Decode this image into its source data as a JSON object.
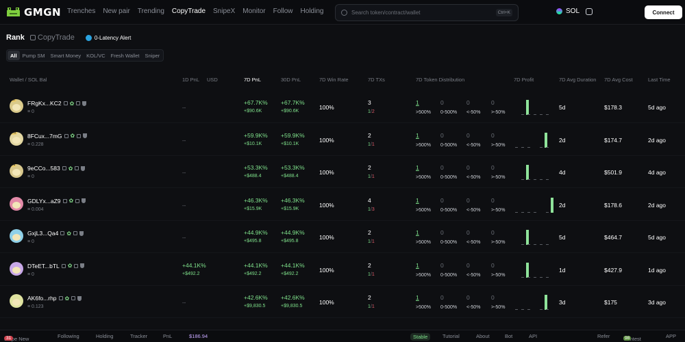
{
  "app": {
    "name": "GMGN"
  },
  "nav": [
    "Trenches",
    "New pair",
    "Trending",
    "CopyTrade",
    "SnipeX",
    "Monitor",
    "Follow",
    "Holding"
  ],
  "search": {
    "placeholder": "Search token/contract/wallet",
    "shortcut": "Ctrl+K"
  },
  "chain": {
    "label": "SOL"
  },
  "connect_label": "Connect",
  "page": {
    "title": "Rank",
    "copytrade": "CopyTrade",
    "alert": "0-Latency Alert"
  },
  "filters": [
    "All",
    "Pump SM",
    "Smart Money",
    "KOL/VC",
    "Fresh Wallet",
    "Sniper"
  ],
  "columns": [
    "Wallet / SOL Bal",
    "1D PnL",
    "USD",
    "7D PnL",
    "30D PnL",
    "7D Win Rate",
    "7D TXs",
    "7D Token Distribution",
    "7D Profit",
    "7D Avg Duration",
    "7D Avg Cost",
    "Last Time"
  ],
  "rows": [
    {
      "badge": "1st",
      "wallet": "FRgKx...KC2",
      "bal": "0",
      "d1": "--",
      "d1usd": "",
      "d7": "+67.7K%",
      "d7usd": "+$90.6K",
      "d30": "+67.7K%",
      "d30usd": "+$90.6K",
      "win": "100%",
      "tx": "3",
      "txw": "1",
      "txl": "2",
      "dist": [
        "1",
        "0",
        "0",
        "0"
      ],
      "bar": 0,
      "dur": "5d",
      "cost": "$178.3",
      "last": "5d ago",
      "avatar": "#d9c98a"
    },
    {
      "badge": "2nd",
      "wallet": "8FCux...7mG",
      "bal": "0.228",
      "d1": "--",
      "d1usd": "",
      "d7": "+59.9K%",
      "d7usd": "+$10.1K",
      "d30": "+59.9K%",
      "d30usd": "+$10.1K",
      "win": "100%",
      "tx": "2",
      "txw": "1",
      "txl": "1",
      "dist": [
        "1",
        "0",
        "0",
        "0"
      ],
      "bar": 3,
      "dur": "2d",
      "cost": "$174.7",
      "last": "2d ago",
      "avatar": "#e3d7a2"
    },
    {
      "badge": "3rd",
      "wallet": "9eCCo...583",
      "bal": "0",
      "d1": "--",
      "d1usd": "",
      "d7": "+53.3K%",
      "d7usd": "+$488.4",
      "d30": "+53.3K%",
      "d30usd": "+$488.4",
      "win": "100%",
      "tx": "2",
      "txw": "1",
      "txl": "1",
      "dist": [
        "1",
        "0",
        "0",
        "0"
      ],
      "bar": 0,
      "dur": "4d",
      "cost": "$501.9",
      "last": "4d ago",
      "avatar": "#d8c88d"
    },
    {
      "badge": "",
      "wallet": "GDLYx...aZ9",
      "bal": "0.004",
      "d1": "--",
      "d1usd": "",
      "d7": "+46.3K%",
      "d7usd": "+$15.9K",
      "d30": "+46.3K%",
      "d30usd": "+$15.9K",
      "win": "100%",
      "tx": "4",
      "txw": "1",
      "txl": "3",
      "dist": [
        "1",
        "0",
        "0",
        "0"
      ],
      "bar": 4,
      "dur": "2d",
      "cost": "$178.6",
      "last": "2d ago",
      "avatar": "#e38aa8"
    },
    {
      "badge": "",
      "wallet": "GxjL3...Qa4",
      "bal": "0",
      "d1": "--",
      "d1usd": "",
      "d7": "+44.9K%",
      "d7usd": "+$495.8",
      "d30": "+44.9K%",
      "d30usd": "+$495.8",
      "win": "100%",
      "tx": "2",
      "txw": "1",
      "txl": "1",
      "dist": [
        "1",
        "0",
        "0",
        "0"
      ],
      "bar": 0,
      "dur": "5d",
      "cost": "$464.7",
      "last": "5d ago",
      "avatar": "#8fd0e8"
    },
    {
      "badge": "",
      "wallet": "DTeET...bTL",
      "bal": "0",
      "d1": "+44.1K%",
      "d1usd": "+$492.2",
      "d7": "+44.1K%",
      "d7usd": "+$492.2",
      "d30": "+44.1K%",
      "d30usd": "+$492.2",
      "win": "100%",
      "tx": "2",
      "txw": "1",
      "txl": "1",
      "dist": [
        "1",
        "0",
        "0",
        "0"
      ],
      "bar": 0,
      "dur": "1d",
      "cost": "$427.9",
      "last": "1d ago",
      "avatar": "#c8a8e8"
    },
    {
      "badge": "",
      "wallet": "AK6fo...rhp",
      "bal": "0.123",
      "d1": "--",
      "d1usd": "",
      "d7": "+42.6K%",
      "d7usd": "+$9,830.5",
      "d30": "+42.6K%",
      "d30usd": "+$9,830.5",
      "win": "100%",
      "tx": "2",
      "txw": "1",
      "txl": "1",
      "dist": [
        "1",
        "0",
        "0",
        "0"
      ],
      "bar": 3,
      "dur": "3d",
      "cost": "$175",
      "last": "3d ago",
      "avatar": "#dfe3a0"
    }
  ],
  "dist_labels": [
    ">500%",
    "0-500%",
    "<-50%",
    ">-50%"
  ],
  "bottom": {
    "snipe": "Snipe New",
    "snipe_count": "31",
    "following": "Following",
    "holding": "Holding",
    "tracker": "Tracker",
    "pnl": "PnL",
    "balance": "$186.94",
    "stable": "Stable",
    "tutorial": "Tutorial",
    "about": "About",
    "bot": "Bot",
    "api": "API",
    "refer": "Refer",
    "contest": "Contest",
    "contest_count": "98",
    "app": "APP"
  }
}
